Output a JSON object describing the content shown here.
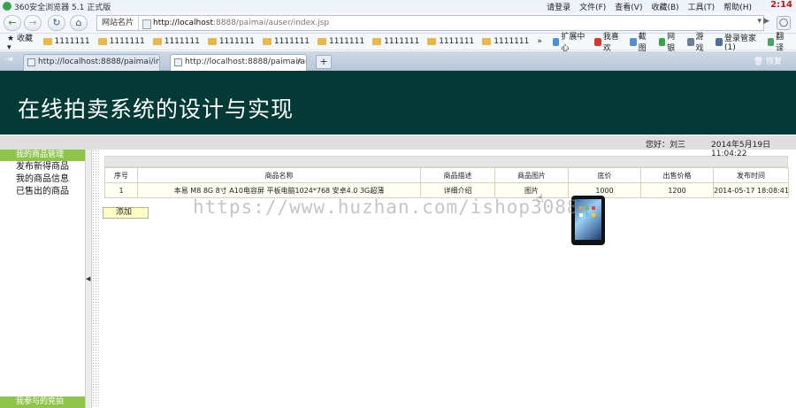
{
  "browser": {
    "app_title": "360安全浏览器 5.1 正式版",
    "menu": [
      "请登录",
      "文件(F)",
      "查看(V)",
      "收藏(B)",
      "工具(T)",
      "帮助(H)"
    ],
    "clock": "2:14",
    "site_label": "网站名片",
    "url_host": "http://localhost",
    "url_rest": ":8888/paimai/auser/index.jsp",
    "favorites_label": "收藏",
    "favorites": [
      "1111111",
      "1111111",
      "1111111",
      "1111111",
      "1111111",
      "1111111",
      "1111111",
      "1111111",
      "1111111"
    ],
    "favorites_more": "»",
    "tools": [
      "扩展中心",
      "我喜欢",
      "截图",
      "网银",
      "游戏",
      "登录管家(1)",
      "翻译"
    ],
    "tabs": [
      {
        "label": "http://localhost:8888/paimai/ind...",
        "active": false
      },
      {
        "label": "http://localhost:8888/paimai/au...",
        "active": true
      }
    ],
    "new_tab": "+",
    "restore": "恢复"
  },
  "page": {
    "banner_title": "在线拍卖系统的设计与实现",
    "user_text": "您好：刘三",
    "date_text": "2014年5月19日  11:04:22",
    "left_menu": {
      "head": "我的商品管理",
      "items": [
        "发布新得商品",
        "我的商品信息",
        "已售出的商品"
      ],
      "bottom_head": "我参与的竞拍"
    },
    "table": {
      "headers": [
        "序号",
        "商品名称",
        "商品描述",
        "商品图片",
        "底价",
        "出售价格",
        "发布时间"
      ],
      "rows": [
        [
          "1",
          "本易 M8 8G 8寸 A10电容屏 平板电脑1024*768 安卓4.0 3G超薄",
          "详细介绍",
          "图片",
          "1000",
          "1200",
          "2014-05-17 18:08:41"
        ]
      ]
    },
    "add_button": "添加",
    "watermark": "https://www.huzhan.com/ishop30884"
  }
}
